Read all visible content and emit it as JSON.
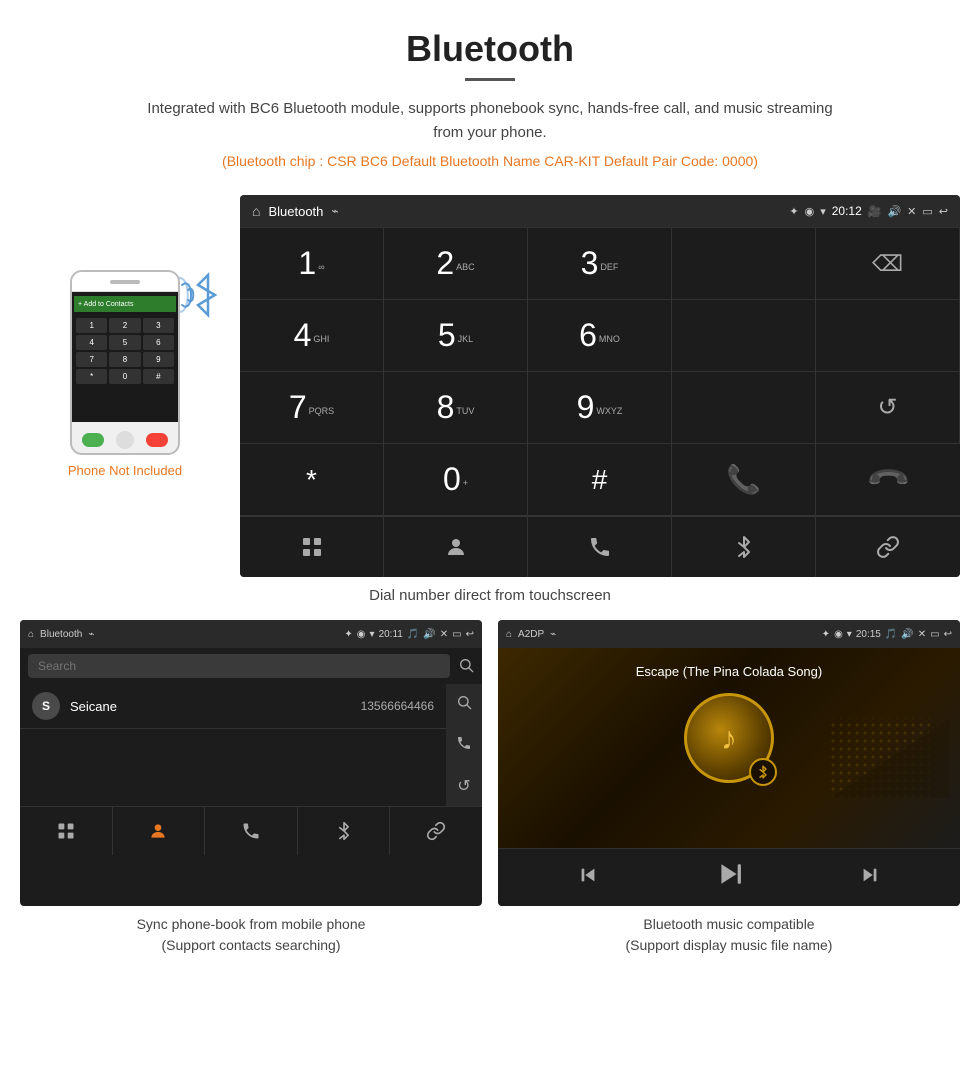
{
  "header": {
    "title": "Bluetooth",
    "description": "Integrated with BC6 Bluetooth module, supports phonebook sync, hands-free call, and music streaming from your phone.",
    "specs": "(Bluetooth chip : CSR BC6    Default Bluetooth Name CAR-KIT    Default Pair Code: 0000)"
  },
  "phone_note": "Phone Not Included",
  "car_screen_dial": {
    "status_bar": {
      "home_icon": "⌂",
      "title": "Bluetooth",
      "usb_icon": "⌁",
      "bt_icon": "✦",
      "location_icon": "◉",
      "wifi_icon": "▾",
      "time": "20:12",
      "camera_icon": "📷",
      "volume_icon": "🔊",
      "close_icon": "✕",
      "screen_icon": "▭",
      "back_icon": "↩"
    },
    "keys": [
      {
        "num": "1",
        "letters": "∞",
        "col": 1
      },
      {
        "num": "2",
        "letters": "ABC",
        "col": 2
      },
      {
        "num": "3",
        "letters": "DEF",
        "col": 3
      },
      {
        "num": "",
        "letters": "",
        "col": 4,
        "empty": true
      },
      {
        "num": "⌫",
        "letters": "",
        "col": 5,
        "backspace": true
      },
      {
        "num": "4",
        "letters": "GHI",
        "col": 1
      },
      {
        "num": "5",
        "letters": "JKL",
        "col": 2
      },
      {
        "num": "6",
        "letters": "MNO",
        "col": 3
      },
      {
        "num": "",
        "letters": "",
        "col": 4,
        "empty": true
      },
      {
        "num": "",
        "letters": "",
        "col": 5,
        "empty": true
      },
      {
        "num": "7",
        "letters": "PQRS",
        "col": 1
      },
      {
        "num": "8",
        "letters": "TUV",
        "col": 2
      },
      {
        "num": "9",
        "letters": "WXYZ",
        "col": 3
      },
      {
        "num": "",
        "letters": "",
        "col": 4,
        "empty": true
      },
      {
        "num": "↺",
        "letters": "",
        "col": 5,
        "reload": true
      },
      {
        "num": "*",
        "letters": "",
        "col": 1,
        "symbol": true
      },
      {
        "num": "0",
        "letters": "+",
        "col": 2
      },
      {
        "num": "#",
        "letters": "",
        "col": 3,
        "symbol": true
      },
      {
        "num": "📞",
        "letters": "",
        "col": 4,
        "call": true
      },
      {
        "num": "📞",
        "letters": "",
        "col": 5,
        "end": true
      }
    ],
    "bottom_nav": [
      "⊞",
      "👤",
      "📞",
      "✦",
      "🔗"
    ]
  },
  "dial_caption": "Dial number direct from touchscreen",
  "phonebook_screen": {
    "status_bar": {
      "home_icon": "⌂",
      "title": "Bluetooth",
      "usb_icon": "⌁",
      "bt_icon": "✦",
      "location_icon": "◉",
      "wifi_icon": "▾",
      "time": "20:11",
      "camera_icon": "🎵",
      "volume_icon": "🔊",
      "close_icon": "✕",
      "screen_icon": "▭",
      "back_icon": "↩"
    },
    "search_placeholder": "Search",
    "contacts": [
      {
        "initial": "S",
        "name": "Seicane",
        "number": "13566664466"
      }
    ],
    "right_icons": [
      "🔍",
      "📞",
      "↺"
    ],
    "bottom_nav": [
      "⊞",
      "👤",
      "📞",
      "✦",
      "🔗"
    ],
    "active_nav": 1
  },
  "phonebook_caption": "Sync phone-book from mobile phone\n(Support contacts searching)",
  "music_screen": {
    "status_bar": {
      "home_icon": "⌂",
      "title": "A2DP",
      "usb_icon": "⌁",
      "bt_icon": "✦",
      "location_icon": "◉",
      "wifi_icon": "▾",
      "time": "20:15",
      "camera_icon": "🎵",
      "volume_icon": "🔊",
      "close_icon": "✕",
      "screen_icon": "▭",
      "back_icon": "↩"
    },
    "song_title": "Escape (The Pina Colada Song)",
    "controls": [
      "⏮",
      "⏭|",
      "⏭"
    ],
    "prev_icon": "⏮",
    "play_pause_icon": "⏭|",
    "next_icon": "⏭"
  },
  "music_caption": "Bluetooth music compatible\n(Support display music file name)"
}
